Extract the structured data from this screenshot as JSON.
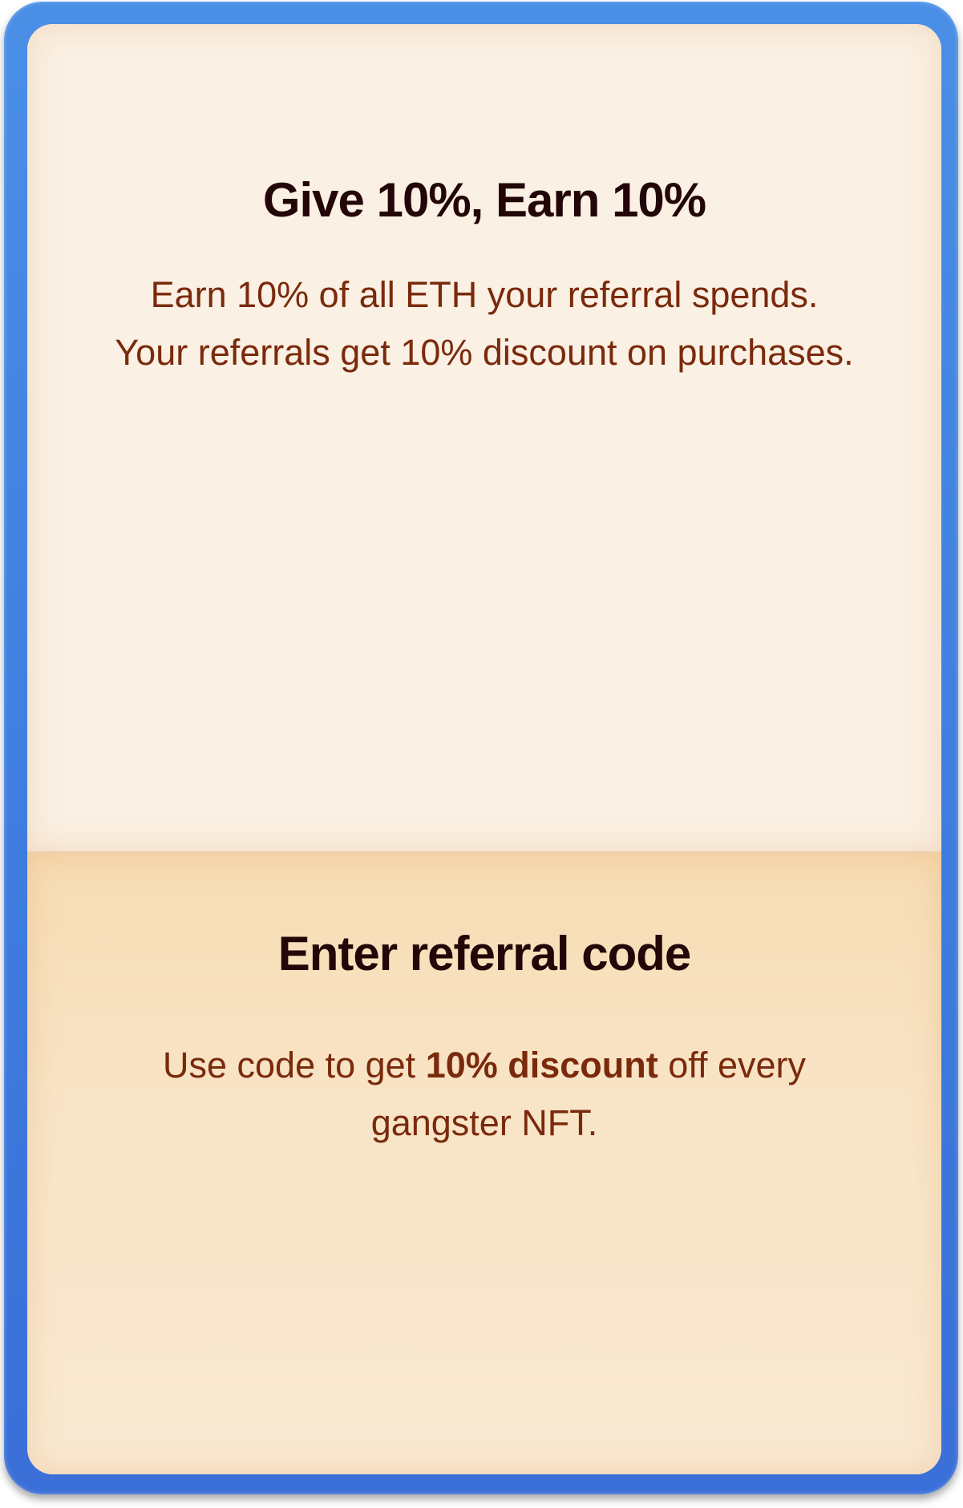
{
  "referral_offer": {
    "title": "Give 10%, Earn 10%",
    "line1": "Earn 10% of all ETH your referral spends.",
    "line2": "Your referrals get 10% discount on purchases."
  },
  "enter_code": {
    "title": "Enter referral code",
    "desc_prefix": "Use code to get ",
    "desc_bold": "10% discount",
    "desc_suffix": " off every gangster NFT."
  },
  "colors": {
    "frame": "#3f7fe0",
    "top_panel": "#faf0e3",
    "bottom_panel": "#f8e2c2",
    "title_text": "#230608",
    "body_text": "#7a2a0c"
  }
}
